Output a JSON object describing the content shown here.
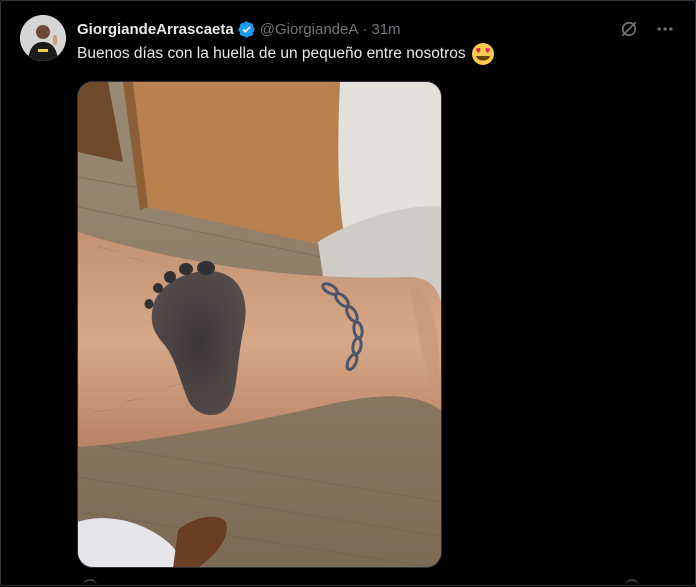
{
  "tweet": {
    "display_name": "GiorgiandeArrascaeta",
    "handle": "@GiorgiandeA",
    "separator": "·",
    "time": "31m",
    "text": "Buenos días con la huella de un pequeño entre nosotros",
    "emoji": "heart-eyes-emoji",
    "verified_color": "#1d9bf0"
  },
  "icons": {
    "grok": "grok-icon",
    "more": "more-icon"
  },
  "colors": {
    "background": "#000000",
    "text": "#e7e9ea",
    "muted": "#71767b",
    "border": "#2f3336"
  }
}
